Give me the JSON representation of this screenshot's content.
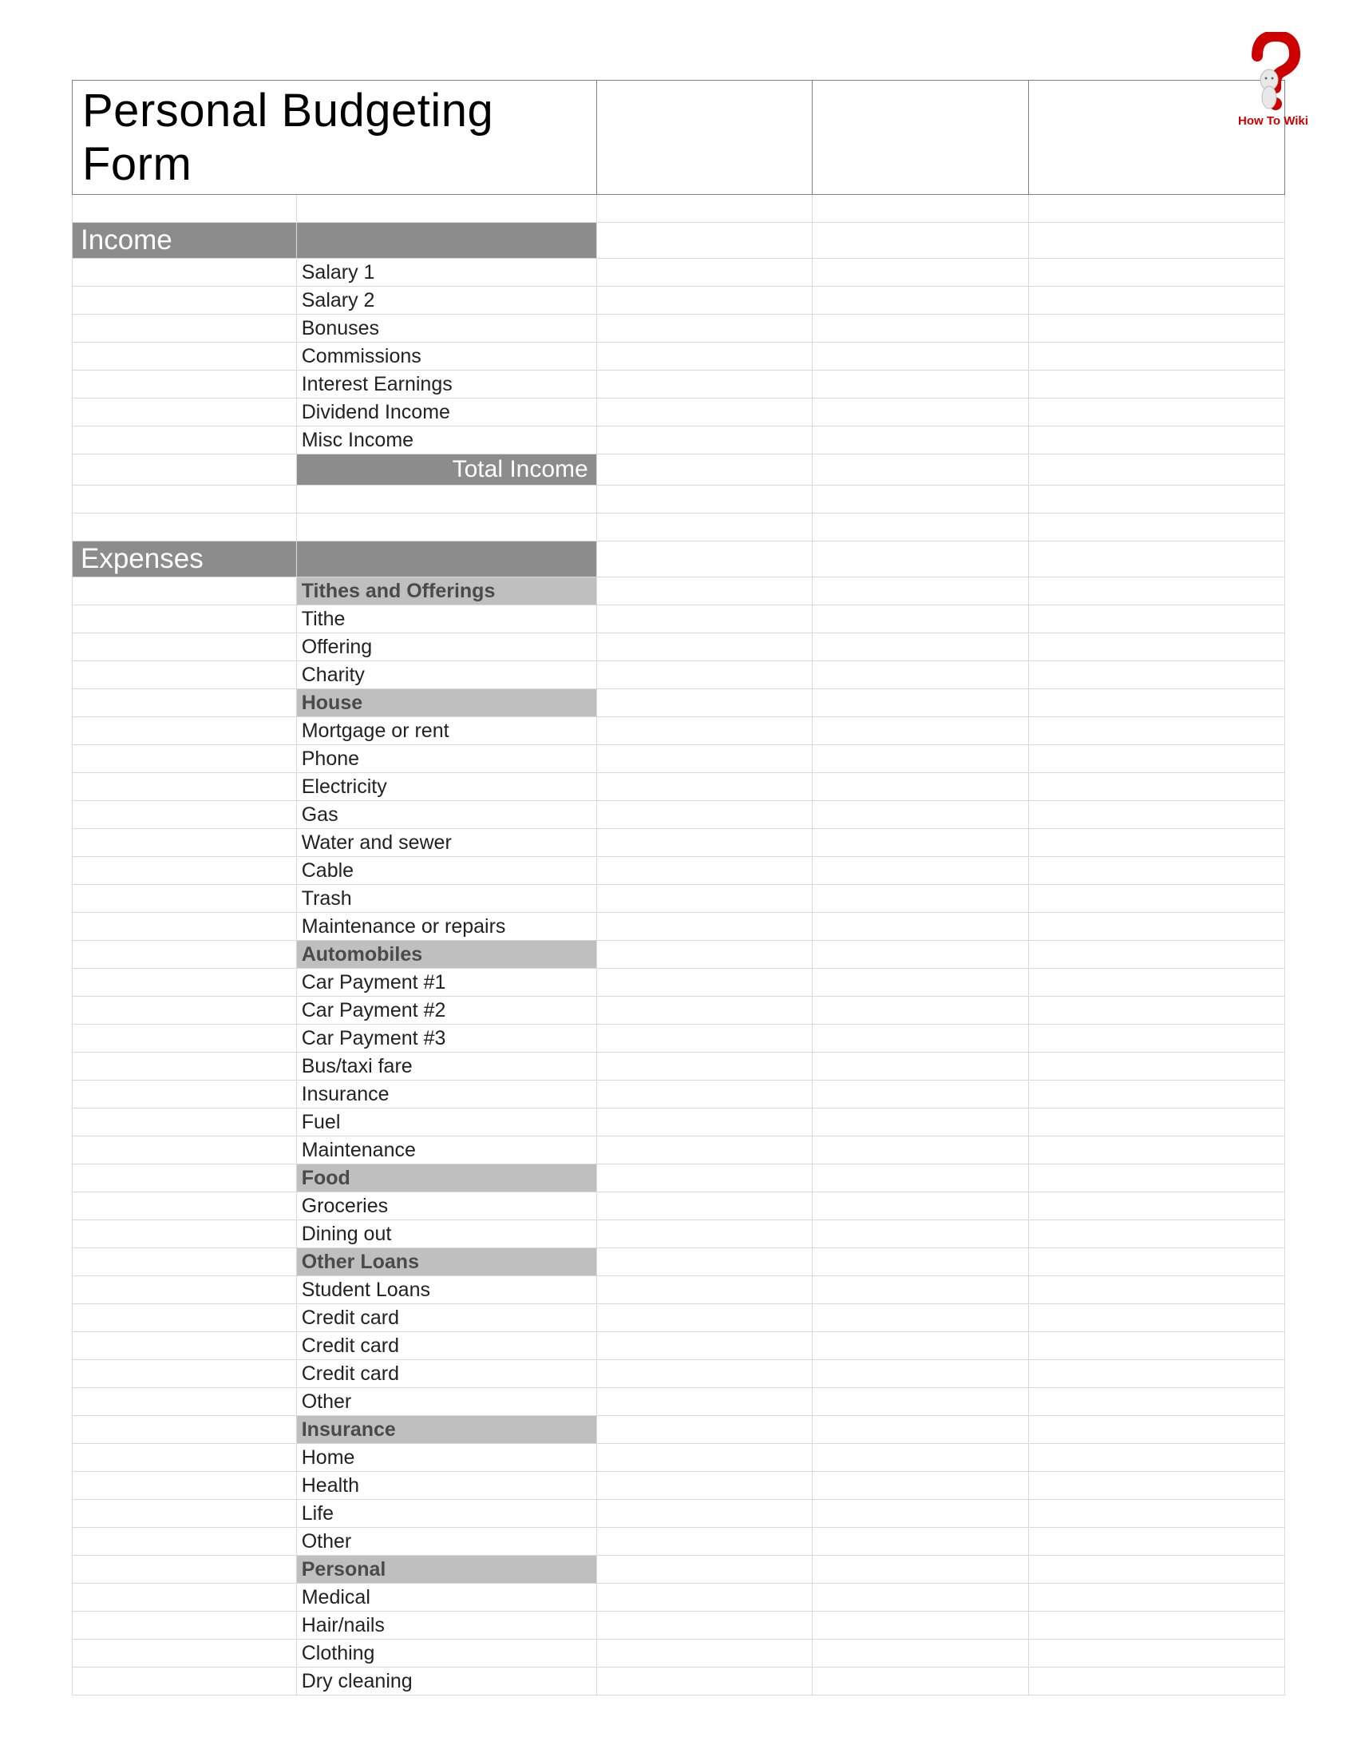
{
  "logo_text": "How To Wiki",
  "title": "Personal Budgeting Form",
  "sections": {
    "income": {
      "header": "Income",
      "items": [
        "Salary 1",
        "Salary 2",
        "Bonuses",
        "Commissions",
        "Interest Earnings",
        "Dividend Income",
        "Misc Income"
      ],
      "total_label": "Total Income"
    },
    "expenses": {
      "header": "Expenses",
      "groups": [
        {
          "header": "Tithes and Offerings",
          "items": [
            "Tithe",
            "Offering",
            "Charity"
          ]
        },
        {
          "header": "House",
          "items": [
            "Mortgage or rent",
            "Phone",
            "Electricity",
            "Gas",
            "Water and sewer",
            "Cable",
            "Trash",
            "Maintenance or repairs"
          ]
        },
        {
          "header": "Automobiles",
          "items": [
            "Car Payment #1",
            "Car Payment #2",
            "Car Payment #3",
            "Bus/taxi fare",
            "Insurance",
            "Fuel",
            "Maintenance"
          ]
        },
        {
          "header": "Food",
          "items": [
            "Groceries",
            "Dining out"
          ]
        },
        {
          "header": "Other Loans",
          "items": [
            "Student Loans",
            "Credit card",
            "Credit card",
            "Credit card",
            "Other"
          ]
        },
        {
          "header": "Insurance",
          "items": [
            "Home",
            "Health",
            "Life",
            "Other"
          ]
        },
        {
          "header": "Personal",
          "items": [
            "Medical",
            "Hair/nails",
            "Clothing",
            "Dry cleaning"
          ]
        }
      ]
    }
  }
}
